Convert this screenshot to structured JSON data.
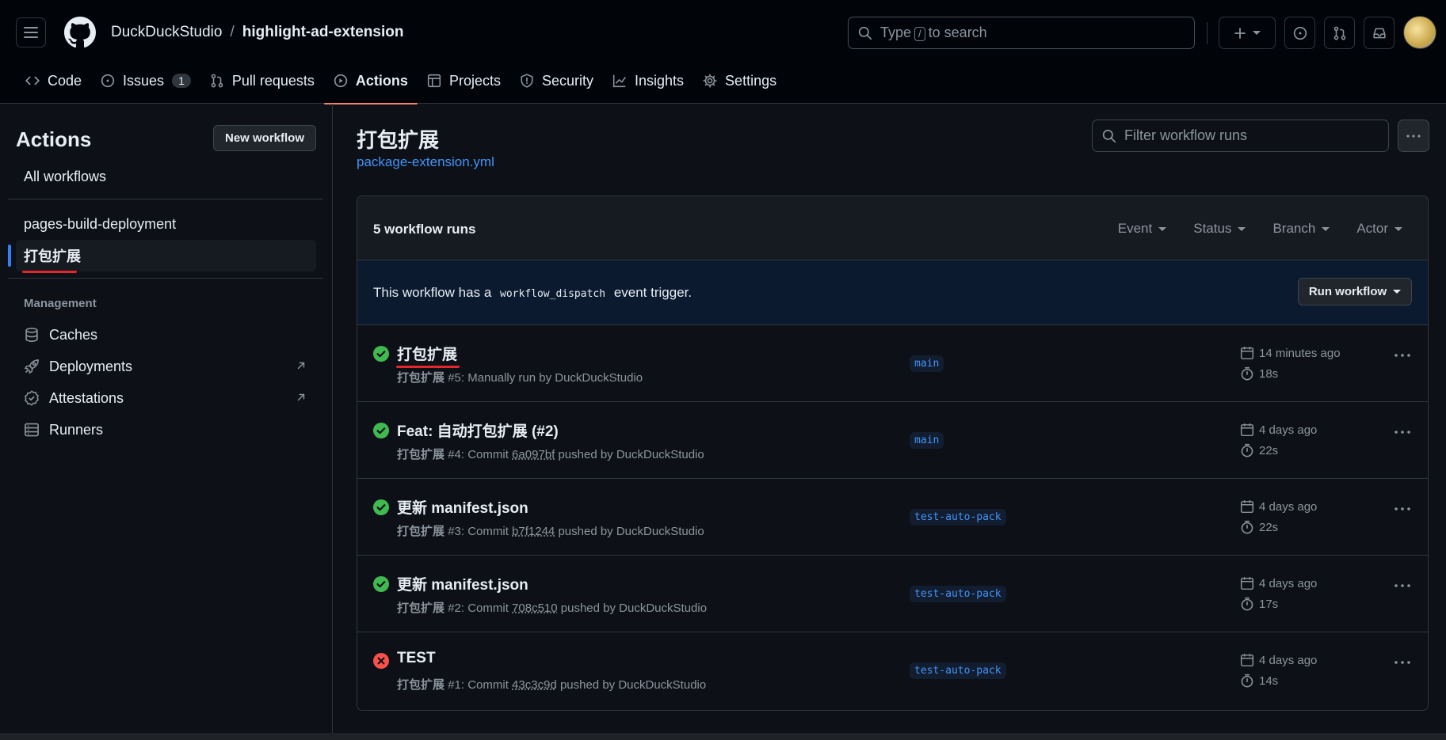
{
  "header": {
    "owner": "DuckDuckStudio",
    "separator": "/",
    "repo": "highlight-ad-extension",
    "search_prefix": "Type",
    "search_key": "/",
    "search_suffix": "to search"
  },
  "repo_nav": {
    "tabs": [
      {
        "label": "Code",
        "icon": "code-icon"
      },
      {
        "label": "Issues",
        "icon": "issue-icon",
        "count": "1"
      },
      {
        "label": "Pull requests",
        "icon": "pull-request-icon"
      },
      {
        "label": "Actions",
        "icon": "play-icon",
        "active": true
      },
      {
        "label": "Projects",
        "icon": "table-icon"
      },
      {
        "label": "Security",
        "icon": "shield-icon"
      },
      {
        "label": "Insights",
        "icon": "graph-icon"
      },
      {
        "label": "Settings",
        "icon": "gear-icon"
      }
    ]
  },
  "sidebar": {
    "title": "Actions",
    "new_workflow": "New workflow",
    "all_workflows": "All workflows",
    "workflows": [
      "pages-build-deployment",
      "打包扩展"
    ],
    "management_heading": "Management",
    "management": [
      {
        "label": "Caches",
        "icon": "database-icon"
      },
      {
        "label": "Deployments",
        "icon": "rocket-icon",
        "external": true
      },
      {
        "label": "Attestations",
        "icon": "verified-icon",
        "external": true
      },
      {
        "label": "Runners",
        "icon": "server-icon"
      }
    ]
  },
  "main": {
    "title": "打包扩展",
    "file": "package-extension.yml",
    "filter_placeholder": "Filter workflow runs",
    "runs_count": "5 workflow runs",
    "filters": [
      "Event",
      "Status",
      "Branch",
      "Actor"
    ],
    "dispatch_prefix": "This workflow has a",
    "dispatch_code": "workflow_dispatch",
    "dispatch_suffix": "event trigger.",
    "run_workflow": "Run workflow"
  },
  "runs": [
    {
      "status": "success",
      "title": "打包扩展",
      "workflow": "打包扩展",
      "detail_prefix": "#5: Manually run by DuckDuckStudio",
      "sha": "",
      "detail_suffix": "",
      "branch": "main",
      "time": "14 minutes ago",
      "duration": "18s"
    },
    {
      "status": "success",
      "title": "Feat: 自动打包扩展 (#2)",
      "workflow": "打包扩展",
      "detail_prefix": "#4: Commit",
      "sha": "6a097bf",
      "detail_suffix": "pushed by DuckDuckStudio",
      "branch": "main",
      "time": "4 days ago",
      "duration": "22s"
    },
    {
      "status": "success",
      "title": "更新 manifest.json",
      "workflow": "打包扩展",
      "detail_prefix": "#3: Commit",
      "sha": "b7f1244",
      "detail_suffix": "pushed by DuckDuckStudio",
      "branch": "test-auto-pack",
      "time": "4 days ago",
      "duration": "22s"
    },
    {
      "status": "success",
      "title": "更新 manifest.json",
      "workflow": "打包扩展",
      "detail_prefix": "#2: Commit",
      "sha": "708c510",
      "detail_suffix": "pushed by DuckDuckStudio",
      "branch": "test-auto-pack",
      "time": "4 days ago",
      "duration": "17s"
    },
    {
      "status": "failure",
      "title": "TEST",
      "workflow": "打包扩展",
      "detail_prefix": "#1: Commit",
      "sha": "43c3c9d",
      "detail_suffix": "pushed by DuckDuckStudio",
      "branch": "test-auto-pack",
      "time": "4 days ago",
      "duration": "14s"
    }
  ],
  "colors": {
    "success": "#3fb950",
    "failure": "#f85149",
    "link": "#4493f8",
    "active_tab_underline": "#f78166",
    "annotation_underline": "#e5262a"
  }
}
